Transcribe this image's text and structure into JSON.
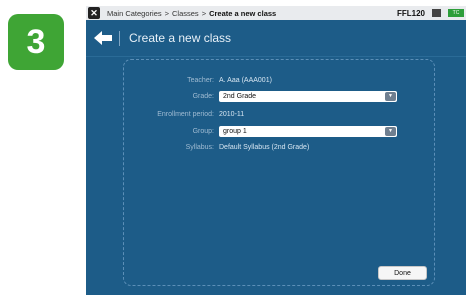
{
  "step": {
    "number": "3"
  },
  "topbar": {
    "close_icon": "close-icon",
    "breadcrumbs": [
      "Main Categories",
      ">",
      "Classes",
      ">",
      "Create a new class"
    ],
    "user_code": "FFL120",
    "status_chip": "TC"
  },
  "header": {
    "title": "Create a new class",
    "back_icon": "back-arrow-icon"
  },
  "form": {
    "teacher": {
      "label": "Teacher:",
      "value": "A. Aaa (AAA001)"
    },
    "grade": {
      "label": "Grade:",
      "value": "2nd Grade"
    },
    "enrollment": {
      "label": "Enrollment period:",
      "value": "2010-11"
    },
    "group": {
      "label": "Group:",
      "value": "group 1"
    },
    "syllabus": {
      "label": "Syllabus:",
      "value": "Default Syllabus (2nd Grade)"
    }
  },
  "actions": {
    "done_label": "Done"
  },
  "colors": {
    "background": "#1d5c88",
    "step_badge": "#3fa535",
    "topbar": "#e9ebee"
  }
}
